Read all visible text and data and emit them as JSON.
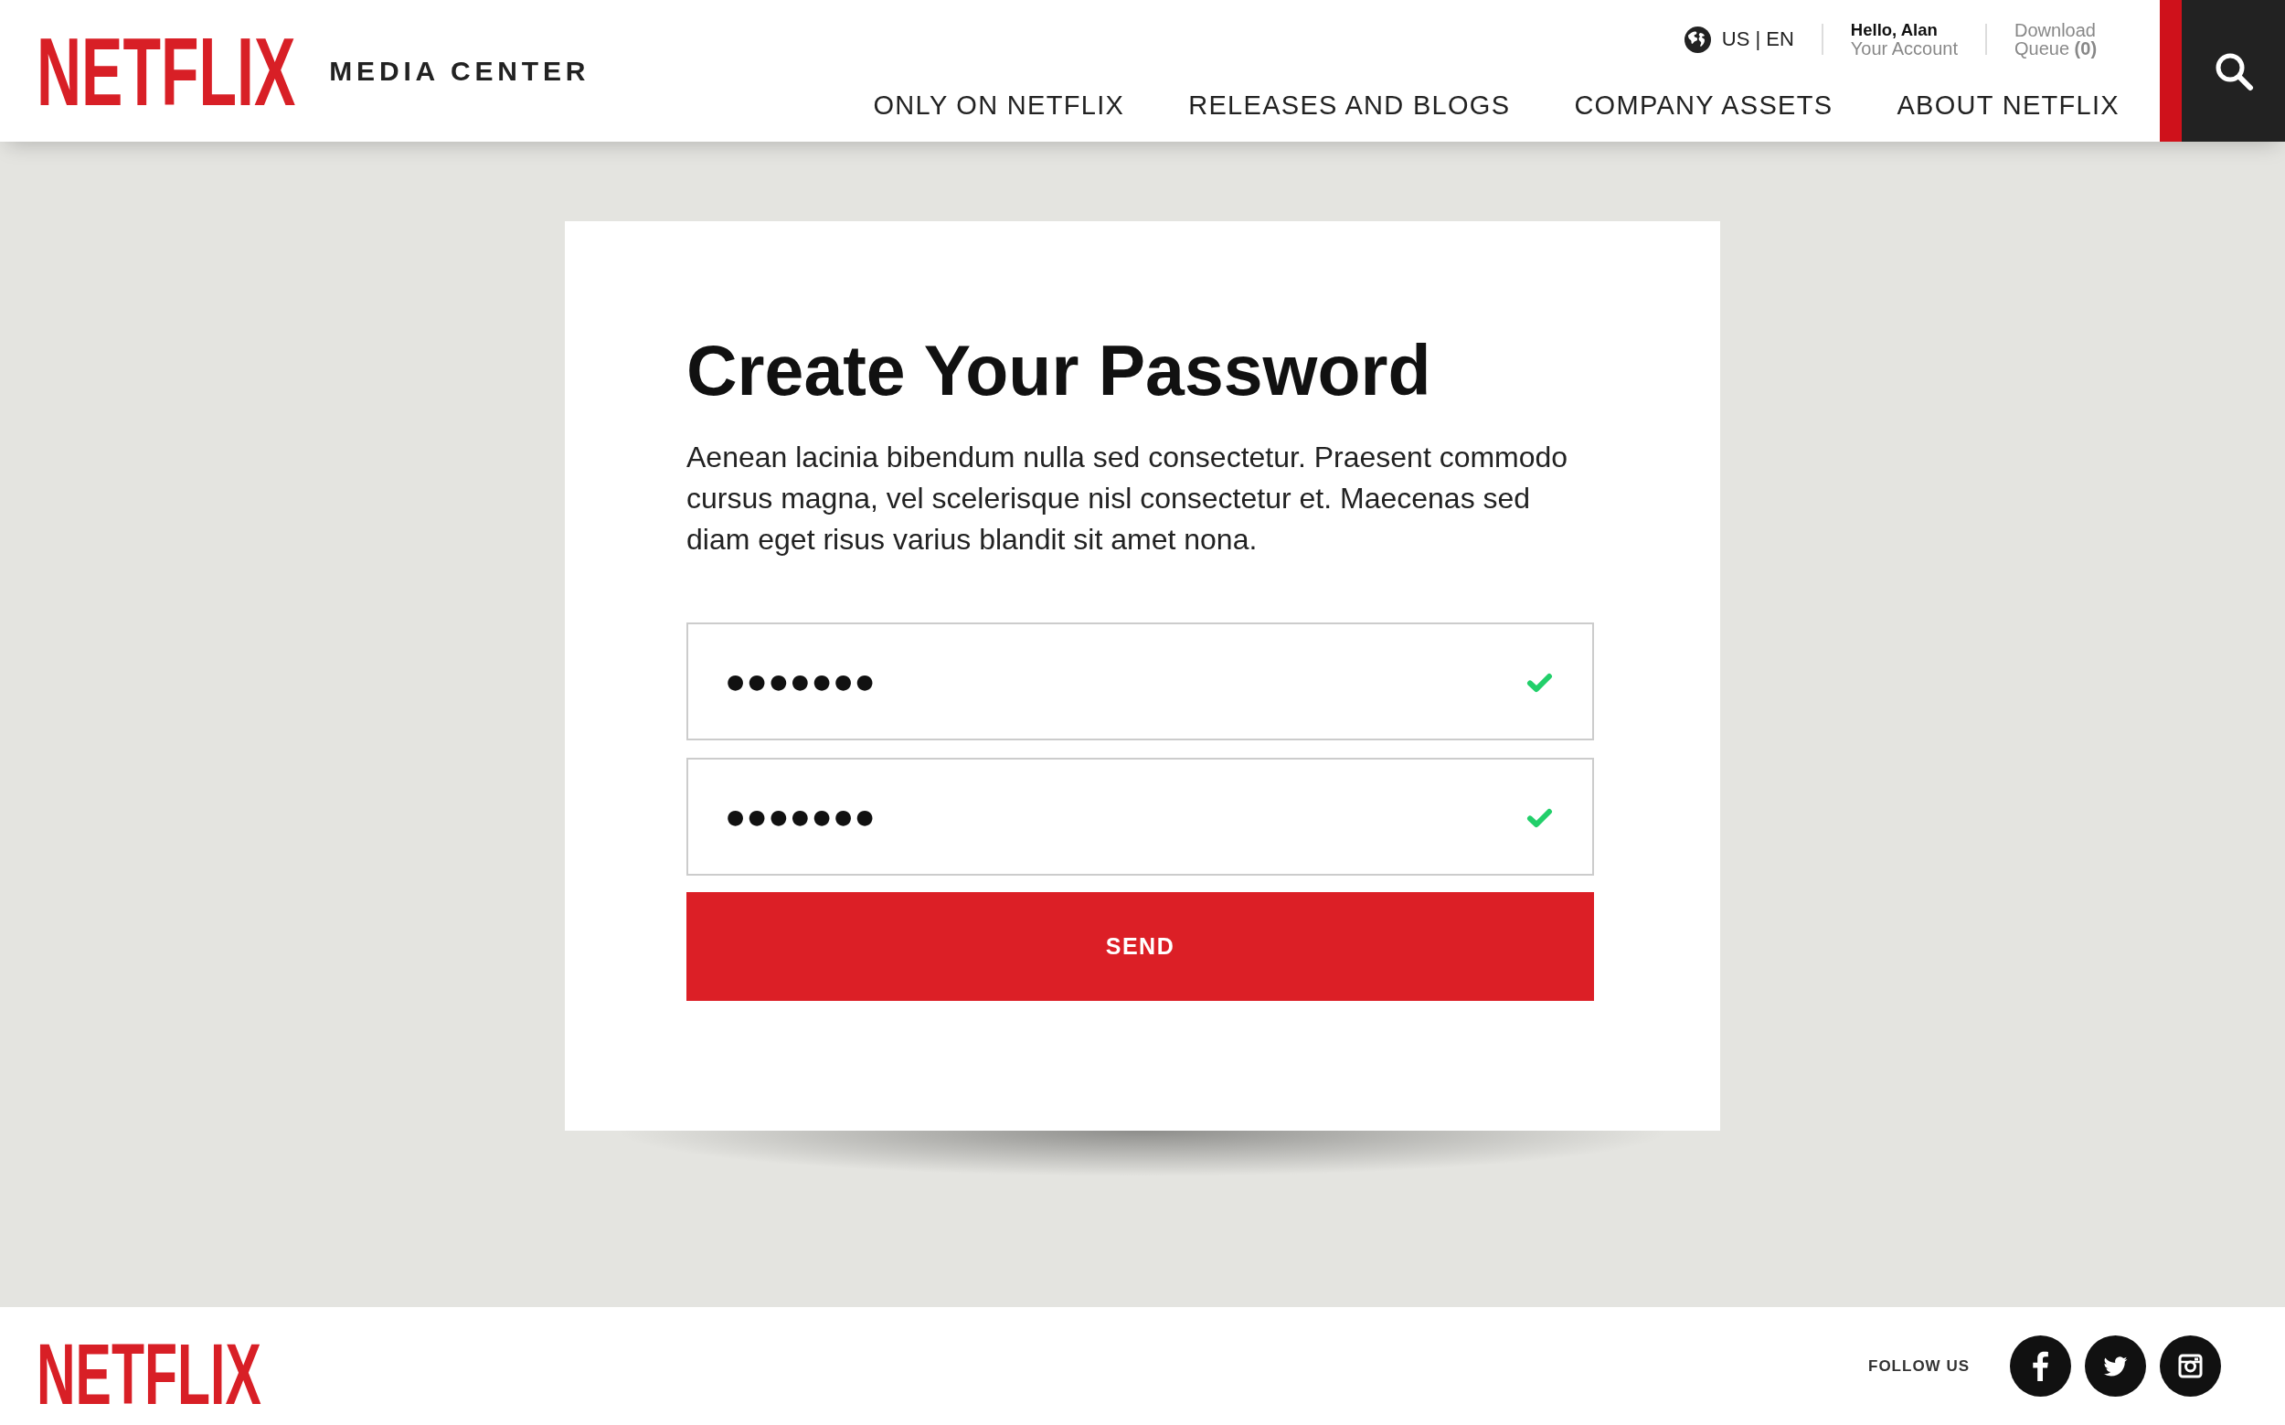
{
  "header": {
    "logo": "NETFLIX",
    "site_name": "MEDIA CENTER",
    "locale": "US | EN",
    "greeting": "Hello, Alan",
    "account_link": "Your Account",
    "download_queue": "Download Queue **(0)**",
    "nav": [
      "ONLY ON NETFLIX",
      "RELEASES AND BLOGS",
      "COMPANY ASSETS",
      "ABOUT NETFLIX"
    ]
  },
  "form": {
    "title": "Create Your Password",
    "description": "Aenean lacinia bibendum nulla sed consectetur. Praesent commodo cursus magna, vel scelerisque nisl consectetur et. Maecenas sed diam eget risus varius blandit sit amet nona.",
    "fields": [
      {
        "value": "●●●●●●●",
        "valid": true
      },
      {
        "value": "●●●●●●●",
        "valid": true
      }
    ],
    "submit": "SEND"
  },
  "footer": {
    "logo": "NETFLIX",
    "follow_label": "FOLLOW US"
  }
}
